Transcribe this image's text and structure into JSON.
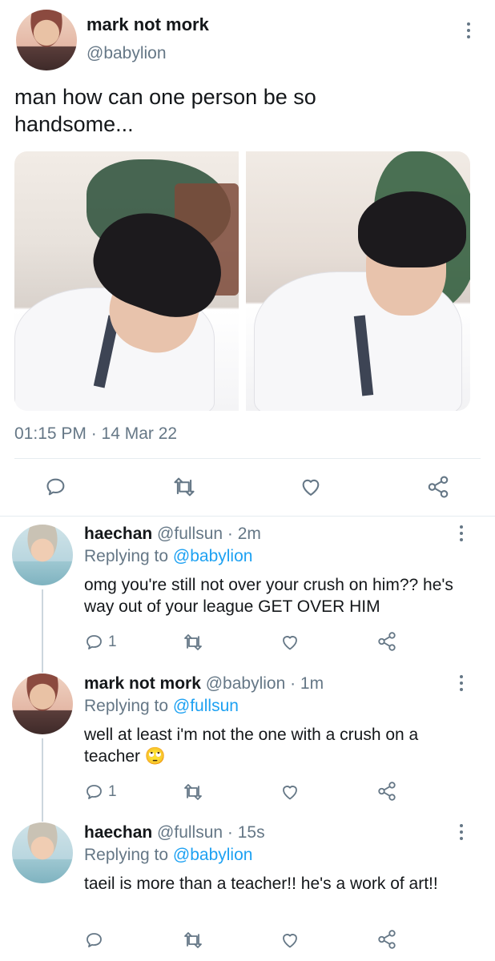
{
  "main_tweet": {
    "display_name": "mark not mork",
    "handle": "@babylion",
    "text": "man how can one person be so handsome...",
    "timestamp": "01:15 PM · 14 Mar 22",
    "actions": [
      "reply-icon",
      "retweet-icon",
      "like-icon",
      "share-icon"
    ]
  },
  "replies": [
    {
      "display_name": "haechan",
      "handle": "@fullsun",
      "age": "· 2m",
      "replying_label": "Replying to",
      "replying_to": "@babylion",
      "text": "omg you're still not over your crush on him?? he's way out of your league GET OVER HIM",
      "reply_count": "1"
    },
    {
      "display_name": "mark not mork",
      "handle": "@babylion",
      "age": "· 1m",
      "replying_label": "Replying to",
      "replying_to": "@fullsun",
      "text": "well at least i'm not the one with a crush on a teacher 🙄",
      "reply_count": "1"
    },
    {
      "display_name": "haechan",
      "handle": "@fullsun",
      "age": "· 15s",
      "replying_label": "Replying to",
      "replying_to": "@babylion",
      "text": "taeil is more than a teacher!! he's a work of art!!",
      "reply_count": ""
    }
  ],
  "colors": {
    "link": "#1da1f2",
    "muted": "#657786",
    "text": "#14171a"
  }
}
